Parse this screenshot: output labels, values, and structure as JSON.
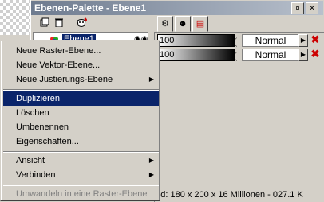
{
  "window": {
    "title": "Ebenen-Palette - Ebene1",
    "pin_glyph": "¤",
    "close_glyph": "✕"
  },
  "toolbar": {
    "new_layer_icon": "new-layer-icon",
    "delete_icon": "trash-icon",
    "mask_icon": "mask-icon"
  },
  "tree": {
    "layer_name": "Ebene1"
  },
  "tabs": [
    "layers-tab",
    "mask-tab",
    "blend-ranges-tab"
  ],
  "rows": [
    {
      "opacity": "100",
      "blend_mode": "Normal"
    },
    {
      "opacity": "100",
      "blend_mode": "Normal"
    }
  ],
  "status": "Bild:  180 x 200 x 16 Millionen - 027.1 K",
  "menu": {
    "items": [
      {
        "label": "Neue Raster-Ebene...",
        "submenu": false
      },
      {
        "label": "Neue Vektor-Ebene...",
        "submenu": false
      },
      {
        "label": "Neue Justierungs-Ebene",
        "submenu": true
      },
      {
        "label": "Duplizieren",
        "submenu": false,
        "selected": true
      },
      {
        "label": "Löschen",
        "submenu": false
      },
      {
        "label": "Umbenennen",
        "submenu": false
      },
      {
        "label": "Eigenschaften...",
        "submenu": false
      },
      {
        "label": "Ansicht",
        "submenu": true
      },
      {
        "label": "Verbinden",
        "submenu": true
      },
      {
        "label": "Umwandeln in eine Raster-Ebene",
        "submenu": false,
        "disabled": true
      }
    ]
  },
  "colors": {
    "selection": "#0a246a",
    "face": "#d4d0c8"
  }
}
